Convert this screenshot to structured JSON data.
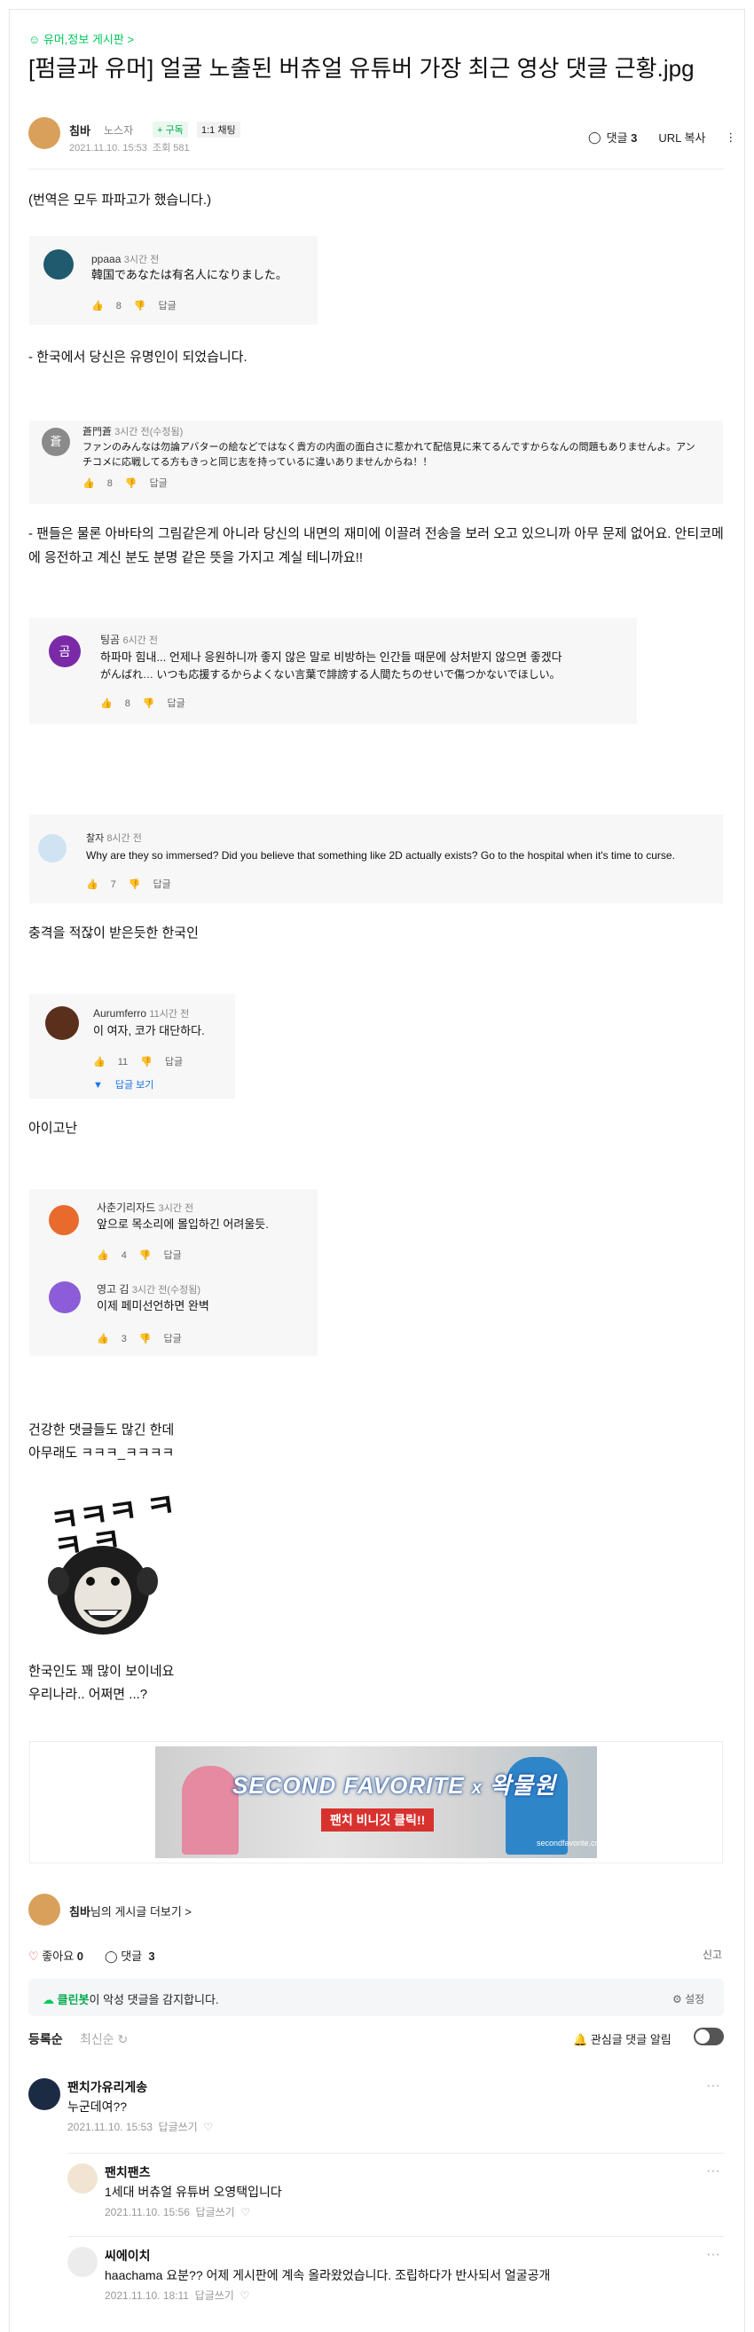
{
  "header": {
    "category": "유머,정보 게시판 >",
    "title": "[펌글과 유머] 얼굴 노출된 버츄얼 유튜버 가장 최근 영상 댓글 근황.jpg",
    "author": "침바",
    "grade": "노스자",
    "subscribe_label": "+ 구독",
    "chat_label": "1:1 채팅",
    "date": "2021.11.10. 15:53",
    "views": "조회 581",
    "comment_label": "댓글",
    "comment_count": "3",
    "url_copy": "URL 복사"
  },
  "post": {
    "intro": "(번역은 모두 파파고가 했습니다.)",
    "shot1": {
      "name": "ppaaa",
      "time": "3시간 전",
      "text": "韓国であなたは有名人になりました。",
      "likes": "8",
      "reply": "답글"
    },
    "line1": "- 한국에서 당신은 유명인이 되었습니다.",
    "shot2": {
      "avatar": "蒼",
      "name": "蒼門蒼",
      "time": "3시간 전(수정됨)",
      "text": "ファンのみんなは勿論アバターの絵などではなく貴方の内面の面白さに惹かれて配信見に来てるんですからなんの問題もありませんよ。アンチコメに応戦してる方もきっと同じ志を持っているに違いありませんからね！！",
      "likes": "8",
      "reply": "답글"
    },
    "line2": "- 팬들은 물론 아바타의 그림같은게 아니라 당신의 내면의 재미에 이끌려 전송을 보러 오고 있으니까 아무 문제 없어요. 안티코메에 응전하고 계신 분도 분명 같은 뜻을 가지고 계실 테니까요!!",
    "shot3": {
      "avatar": "곰",
      "name": "팅곰",
      "time": "6시간 전",
      "text1": "하파마 힘내... 언제나 응원하니까 좋지 않은 말로 비방하는 인간들 때문에 상처받지 않으면 좋겠다",
      "text2": "がんばれ… いつも応援するからよくない言葉で誹謗する人間たちのせいで傷つかないでほしい。",
      "likes": "8",
      "reply": "답글"
    },
    "shot4": {
      "name": "찰자",
      "time": "8시간 전",
      "text": "Why are they so immersed? Did you believe that something like 2D actually exists? Go to the hospital when it's time to curse.",
      "likes": "7",
      "reply": "답글"
    },
    "line3": "충격을 적잖이 받은듯한 한국인",
    "shot5": {
      "name": "Aurumferro",
      "time": "11시간 전",
      "text": "이 여자, 코가 대단하다.",
      "likes": "11",
      "reply": "답글",
      "more": "답글 보기"
    },
    "line4": "아이고난",
    "shot6": {
      "name": "사춘기리자드",
      "time": "3시간 전",
      "text": "앞으로 목소리에 몰입하긴 어려울듯.",
      "likes": "4",
      "reply": "답글",
      "name2": "영고 김",
      "time2": "3시간 전(수정됨)",
      "text2": "이제 페미선언하면 완벽",
      "likes2": "3",
      "reply2": "답글"
    },
    "line5": "건강한 댓글들도 많긴 한데",
    "line6": "아무래도 ㅋㅋㅋ_ㅋㅋㅋㅋ",
    "meme_text": "ㅋㅋㅋ ㅋㅋ ㅋ",
    "line7": "한국인도 꽤 많이 보이네요",
    "line8": "우리나라.. 어쩌면 ...?"
  },
  "ad": {
    "title": "SECOND FAVORITE",
    "x": "x",
    "brand": "왁물원",
    "button": "팬치 비니깃 클릭!!",
    "site": "secondfavorite.co.kr"
  },
  "footer": {
    "more_posts_author": "침바",
    "more_posts_suffix": "님의 게시글 더보기 >",
    "like_label": "좋아요",
    "like_count": "0",
    "comment_label": "댓글",
    "comment_count": "3",
    "report": "신고",
    "cleanbot_name": "클린봇",
    "cleanbot_text": "이 악성 댓글을 감지합니다.",
    "settings": "설정",
    "sort_registered": "등록순",
    "sort_latest": "최신순",
    "notify_label": "관심글 댓글 알림"
  },
  "comments": [
    {
      "nick": "팬치가유리게송",
      "text": "누군데여??",
      "date": "2021.11.10. 15:53",
      "reply": "답글쓰기"
    },
    {
      "nick": "팬치팬츠",
      "text": "1세대 버츄얼 유튜버 오영택입니다",
      "date": "2021.11.10. 15:56",
      "reply": "답글쓰기"
    },
    {
      "nick": "씨에이치",
      "text": "haachama 요분?? 어제 게시판에 계속 올라왔었습니다. 조립하다가 반사되서 얼굴공개",
      "date": "2021.11.10. 18:11",
      "reply": "답글쓰기"
    }
  ],
  "colors": {
    "accent": "#03c75a",
    "link": "#1a73e8",
    "heart": "#e0424a"
  }
}
